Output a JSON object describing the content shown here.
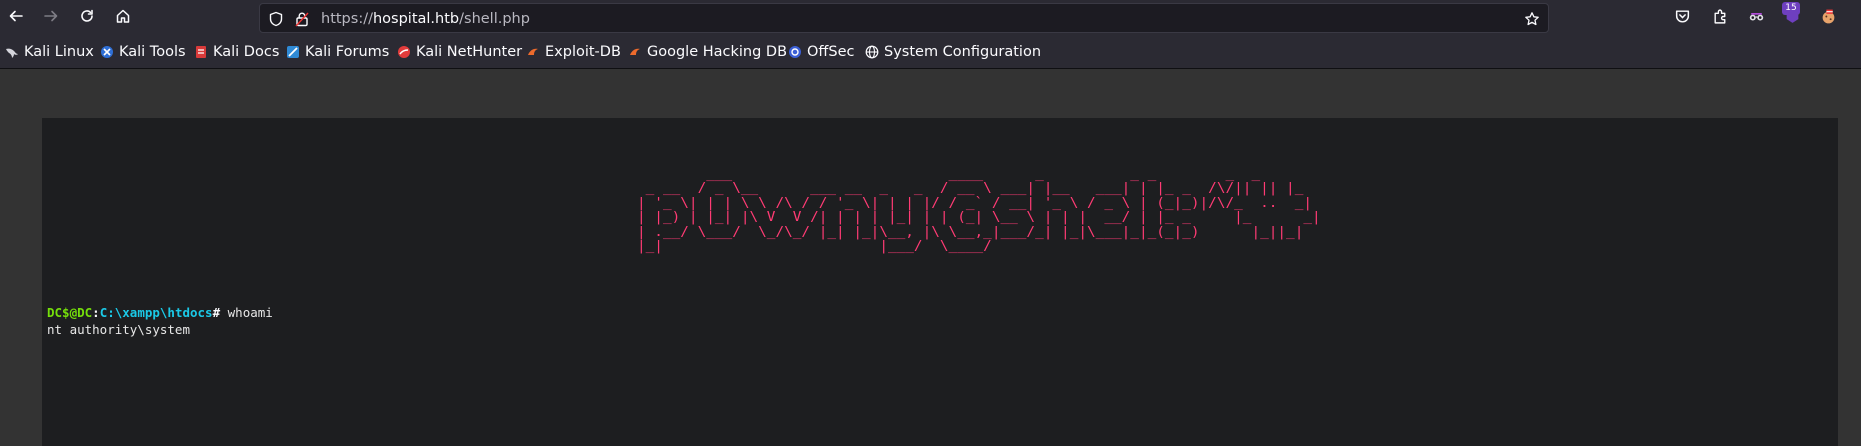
{
  "browser": {
    "url": {
      "prefix": "https://",
      "host": "hospital.htb",
      "path": "/shell.php"
    },
    "extensions_badge": "15",
    "icons": [
      "back-icon",
      "forward-icon",
      "reload-icon",
      "home-icon",
      "shield-icon",
      "lock-icon",
      "bookmark-star-icon",
      "pocket-icon",
      "extensions-icon",
      "extension-glasses-icon",
      "extension-ublock-icon",
      "extension-cookie-icon"
    ]
  },
  "bookmarks": [
    {
      "label": "Kali Linux",
      "icon": "kali-dragon-icon"
    },
    {
      "label": "Kali Tools",
      "icon": "kali-tools-icon"
    },
    {
      "label": "Kali Docs",
      "icon": "kali-docs-icon"
    },
    {
      "label": "Kali Forums",
      "icon": "kali-forums-icon"
    },
    {
      "label": "Kali NetHunter",
      "icon": "kali-nethunter-icon"
    },
    {
      "label": "Exploit-DB",
      "icon": "exploit-db-icon"
    },
    {
      "label": "Google Hacking DB",
      "icon": "ghdb-icon"
    },
    {
      "label": "OffSec",
      "icon": "offsec-icon"
    },
    {
      "label": "System Configuration",
      "icon": "globe-icon"
    }
  ],
  "terminal": {
    "banner": "        ___                         ____      _          _ _        _  _   \n _ __  / _ \\__      ___ __  _   _  / __ \\ ___| |__   ___| | |_ _  /\\/|| || |_ \n| '_ \\| | | \\ \\ /\\ / / '_ \\| | | |/ / _` / __| '_ \\ / _ \\ | (_|_)|/\\/_  ..  _|\n| |_) | |_| |\\ V  V /| | | | |_| | | (_| \\__ \\ | | |  __/ | |_ _     |_      _|\n| .__/ \\___/  \\_/\\_/ |_| |_|\\__, |\\ \\__,_|___/_| |_|\\___|_|_(_|_)      |_||_|  \n|_|                         |___/  \\____/                                    ",
    "prompt_user": "DC$@DC",
    "prompt_sep": ":",
    "prompt_cwd": "C:\\xampp\\htdocs",
    "prompt_hash": "#",
    "command": "whoami",
    "output": "nt authority\\system"
  }
}
